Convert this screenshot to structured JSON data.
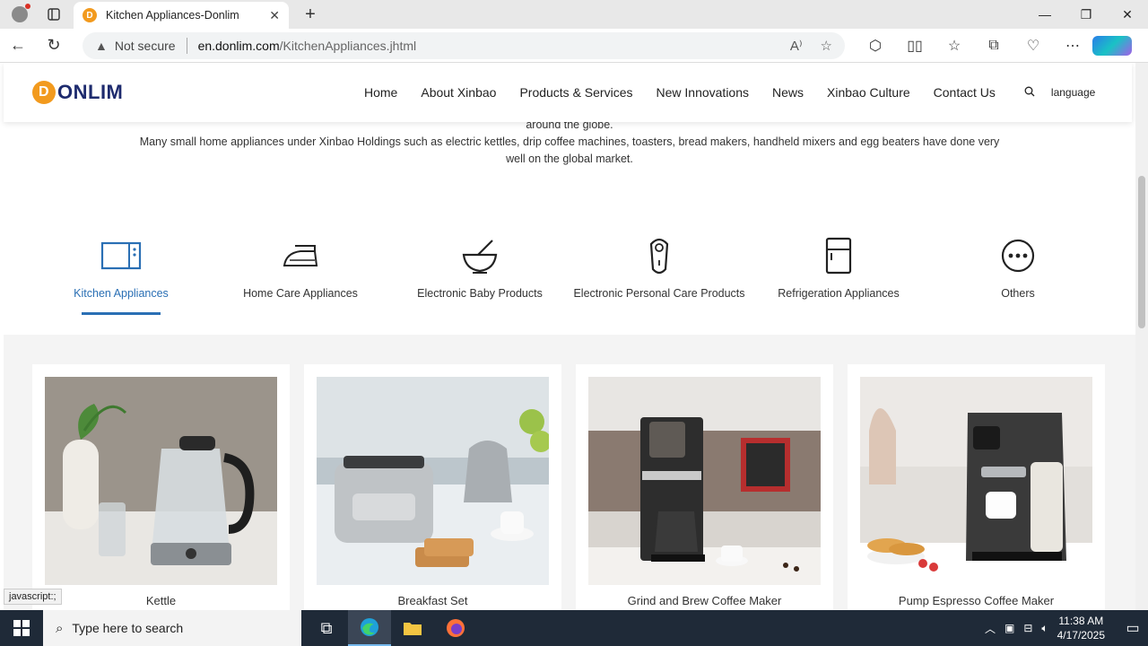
{
  "browser": {
    "tab_title": "Kitchen Appliances-Donlim",
    "tab_favicon": "D",
    "url_warning": "Not secure",
    "url_host": "en.donlim.com",
    "url_path": "/KitchenAppliances.jhtml",
    "status_text": "javascript:;"
  },
  "site": {
    "logo_letter": "D",
    "logo_text": "ONLIM",
    "nav": [
      "Home",
      "About Xinbao",
      "Products & Services",
      "New Innovations",
      "News",
      "Xinbao Culture",
      "Contact Us"
    ],
    "language": "language"
  },
  "intro": {
    "line1": "around the globe.",
    "line2": "Many small home appliances under Xinbao Holdings such as electric kettles, drip coffee machines, toasters, bread makers, handheld mixers and egg beaters have done very well on the global market."
  },
  "categories": [
    {
      "label": "Kitchen Appliances",
      "icon": "microwave-icon",
      "active": true
    },
    {
      "label": "Home Care Appliances",
      "icon": "iron-icon",
      "active": false
    },
    {
      "label": "Electronic Baby Products",
      "icon": "bowl-icon",
      "active": false
    },
    {
      "label": "Electronic Personal Care Products",
      "icon": "shaver-icon",
      "active": false
    },
    {
      "label": "Refrigeration Appliances",
      "icon": "fridge-icon",
      "active": false
    },
    {
      "label": "Others",
      "icon": "more-icon",
      "active": false
    }
  ],
  "products": [
    {
      "name": "Kettle"
    },
    {
      "name": "Breakfast Set"
    },
    {
      "name": "Grind and Brew Coffee Maker"
    },
    {
      "name": "Pump Espresso Coffee Maker"
    }
  ],
  "taskbar": {
    "search_placeholder": "Type here to search",
    "time": "11:38 AM",
    "date": "4/17/2025"
  },
  "colors": {
    "accent": "#2a6fb4",
    "logo_orange": "#f29a1e",
    "logo_navy": "#1e2b6e"
  }
}
